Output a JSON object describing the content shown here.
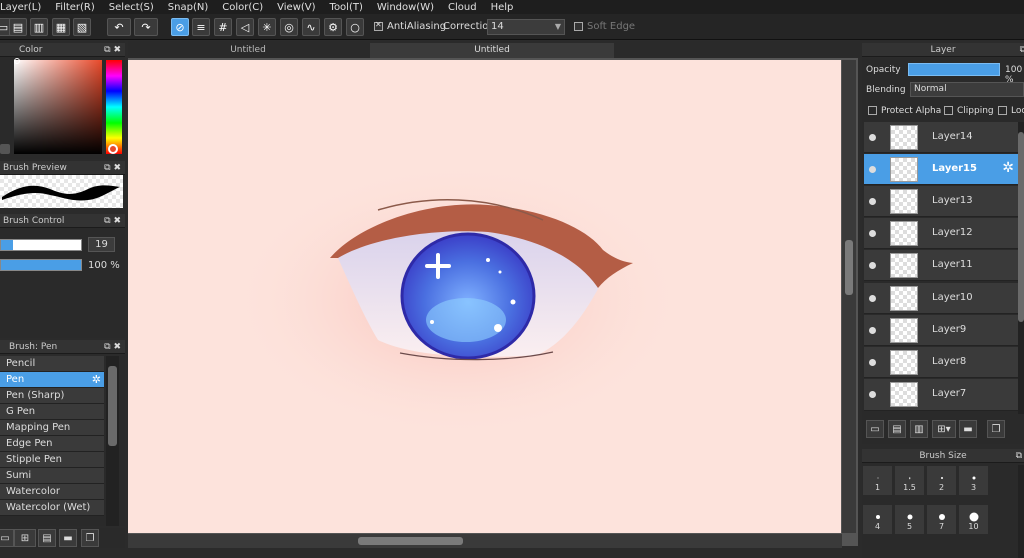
{
  "menu": [
    "Layer(L)",
    "Filter(R)",
    "Select(S)",
    "Snap(N)",
    "Color(C)",
    "View(V)",
    "Tool(T)",
    "Window(W)",
    "Cloud",
    "Help"
  ],
  "toolbar": {
    "antialiasing_label": "AntiAliasing",
    "correction_label": "Correction",
    "correction_value": "14",
    "soft_edge_label": "Soft Edge"
  },
  "panels": {
    "color_title": "Color",
    "brush_preview_title": "Brush Preview",
    "brush_control_title": "Brush Control",
    "brush_size_value": "19",
    "brush_opacity_value": "100 %",
    "brush_opacity_fraction": 1.0,
    "brush_list_title": "Brush: Pen"
  },
  "brushes": [
    {
      "label": "Pencil",
      "selected": false
    },
    {
      "label": "Pen",
      "selected": true
    },
    {
      "label": "Pen (Sharp)",
      "selected": false
    },
    {
      "label": "G Pen",
      "selected": false
    },
    {
      "label": "Mapping Pen",
      "selected": false
    },
    {
      "label": "Edge Pen",
      "selected": false
    },
    {
      "label": "Stipple Pen",
      "selected": false
    },
    {
      "label": "Sumi",
      "selected": false
    },
    {
      "label": "Watercolor",
      "selected": false
    },
    {
      "label": "Watercolor (Wet)",
      "selected": false
    }
  ],
  "tabs": [
    {
      "label": "Untitled",
      "active": false
    },
    {
      "label": "Untitled",
      "active": true
    }
  ],
  "layer_panel": {
    "title": "Layer",
    "opacity_label": "Opacity",
    "opacity_value": "100 %",
    "blending_label": "Blending",
    "blending_value": "Normal",
    "protect_alpha_label": "Protect Alpha",
    "clipping_label": "Clipping",
    "lock_label": "Loc"
  },
  "layers": [
    {
      "name": "Layer14",
      "selected": false
    },
    {
      "name": "Layer15",
      "selected": true
    },
    {
      "name": "Layer13",
      "selected": false
    },
    {
      "name": "Layer12",
      "selected": false
    },
    {
      "name": "Layer11",
      "selected": false
    },
    {
      "name": "Layer10",
      "selected": false
    },
    {
      "name": "Layer9",
      "selected": false
    },
    {
      "name": "Layer8",
      "selected": false
    },
    {
      "name": "Layer7",
      "selected": false
    }
  ],
  "brush_size_panel": {
    "title": "Brush Size",
    "sizes": [
      "1",
      "1.5",
      "2",
      "3",
      "4",
      "5",
      "7",
      "10"
    ]
  },
  "colors": {
    "accent": "#4a9ee6",
    "canvas_bg": "#fde3dc",
    "current_color": "#e8492a"
  }
}
